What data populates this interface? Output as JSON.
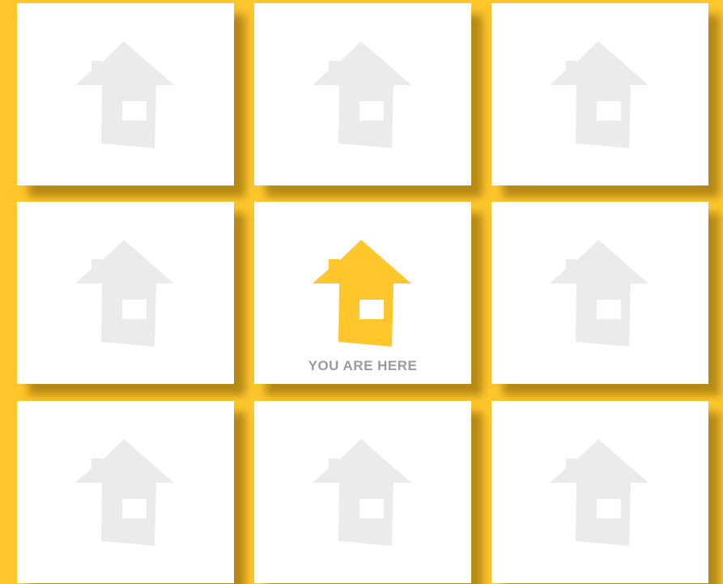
{
  "colors": {
    "background": "#FFC72C",
    "tile": "#FFFFFF",
    "house_inactive": "#EBEBEB",
    "house_active": "#FFC72C",
    "label": "#9A9A9A"
  },
  "grid": {
    "rows": 3,
    "columns": 3,
    "current_tile": {
      "row": 2,
      "column": 2
    }
  },
  "tiles": [
    {
      "icon": "house-icon",
      "active": false,
      "label": ""
    },
    {
      "icon": "house-icon",
      "active": false,
      "label": ""
    },
    {
      "icon": "house-icon",
      "active": false,
      "label": ""
    },
    {
      "icon": "house-icon",
      "active": false,
      "label": ""
    },
    {
      "icon": "house-icon",
      "active": true,
      "label": "YOU ARE HERE"
    },
    {
      "icon": "house-icon",
      "active": false,
      "label": ""
    },
    {
      "icon": "house-icon",
      "active": false,
      "label": ""
    },
    {
      "icon": "house-icon",
      "active": false,
      "label": ""
    },
    {
      "icon": "house-icon",
      "active": false,
      "label": ""
    }
  ]
}
